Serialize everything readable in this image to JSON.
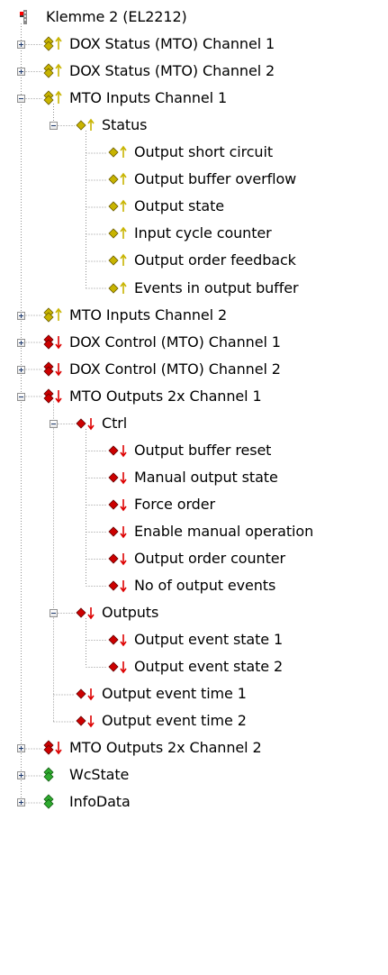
{
  "colors": {
    "input_diamond": "#c8b400",
    "input_arrow": "#c8b400",
    "output_diamond": "#cc0000",
    "output_arrow": "#dd0000",
    "status_green": "#2faa2f",
    "terminal_red": "#ff0000",
    "tree_line": "#8f8f8f"
  },
  "tree": {
    "root": {
      "label": "Klemme 2 (EL2212)",
      "icon": "terminal-icon"
    },
    "nodes": [
      {
        "id": "dox-status-1",
        "label": "DOX Status (MTO) Channel 1",
        "icon": "input-group-icon",
        "expander": "plus",
        "level": 1
      },
      {
        "id": "dox-status-2",
        "label": "DOX Status (MTO) Channel 2",
        "icon": "input-group-icon",
        "expander": "plus",
        "level": 1
      },
      {
        "id": "mto-inputs-1",
        "label": "MTO Inputs Channel 1",
        "icon": "input-group-icon",
        "expander": "minus",
        "level": 1
      },
      {
        "id": "status",
        "label": "Status",
        "icon": "input-var-icon",
        "expander": "minus",
        "level": 2
      },
      {
        "id": "output-short-circuit",
        "label": "Output short circuit",
        "icon": "input-var-icon",
        "level": 3
      },
      {
        "id": "output-buffer-overflow",
        "label": "Output buffer overflow",
        "icon": "input-var-icon",
        "level": 3
      },
      {
        "id": "output-state",
        "label": "Output state",
        "icon": "input-var-icon",
        "level": 3
      },
      {
        "id": "input-cycle-counter",
        "label": "Input cycle counter",
        "icon": "input-var-icon",
        "level": 3
      },
      {
        "id": "output-order-feedback",
        "label": "Output order feedback",
        "icon": "input-var-icon",
        "level": 3
      },
      {
        "id": "events-in-output-buffer",
        "label": "Events in output buffer",
        "icon": "input-var-icon",
        "level": 3
      },
      {
        "id": "mto-inputs-2",
        "label": "MTO Inputs Channel 2",
        "icon": "input-group-icon",
        "expander": "plus",
        "level": 1
      },
      {
        "id": "dox-control-1",
        "label": "DOX Control (MTO) Channel 1",
        "icon": "output-group-icon",
        "expander": "plus",
        "level": 1
      },
      {
        "id": "dox-control-2",
        "label": "DOX Control (MTO) Channel 2",
        "icon": "output-group-icon",
        "expander": "plus",
        "level": 1
      },
      {
        "id": "mto-outputs-1",
        "label": "MTO Outputs 2x Channel 1",
        "icon": "output-group-icon",
        "expander": "minus",
        "level": 1
      },
      {
        "id": "ctrl",
        "label": "Ctrl",
        "icon": "output-var-icon",
        "expander": "minus",
        "level": 2
      },
      {
        "id": "output-buffer-reset",
        "label": "Output buffer reset",
        "icon": "output-var-icon",
        "level": 3
      },
      {
        "id": "manual-output-state",
        "label": "Manual output state",
        "icon": "output-var-icon",
        "level": 3
      },
      {
        "id": "force-order",
        "label": "Force order",
        "icon": "output-var-icon",
        "level": 3
      },
      {
        "id": "enable-manual-operation",
        "label": "Enable manual operation",
        "icon": "output-var-icon",
        "level": 3
      },
      {
        "id": "output-order-counter",
        "label": "Output order counter",
        "icon": "output-var-icon",
        "level": 3
      },
      {
        "id": "no-of-output-events",
        "label": "No of output events",
        "icon": "output-var-icon",
        "level": 3
      },
      {
        "id": "outputs",
        "label": "Outputs",
        "icon": "output-var-icon",
        "expander": "minus",
        "level": 2
      },
      {
        "id": "output-event-state-1",
        "label": "Output event state 1",
        "icon": "output-var-icon",
        "level": 3
      },
      {
        "id": "output-event-state-2",
        "label": "Output event state 2",
        "icon": "output-var-icon",
        "level": 3
      },
      {
        "id": "output-event-time-1",
        "label": "Output event time 1",
        "icon": "output-var-icon",
        "level": 2
      },
      {
        "id": "output-event-time-2",
        "label": "Output event time 2",
        "icon": "output-var-icon",
        "level": 2
      },
      {
        "id": "mto-outputs-2",
        "label": "MTO Outputs 2x Channel 2",
        "icon": "output-group-icon",
        "expander": "plus",
        "level": 1
      },
      {
        "id": "wcstate",
        "label": "WcState",
        "icon": "status-group-icon",
        "expander": "plus",
        "level": 1
      },
      {
        "id": "infodata",
        "label": "InfoData",
        "icon": "status-group-icon",
        "expander": "plus",
        "level": 1
      }
    ]
  }
}
